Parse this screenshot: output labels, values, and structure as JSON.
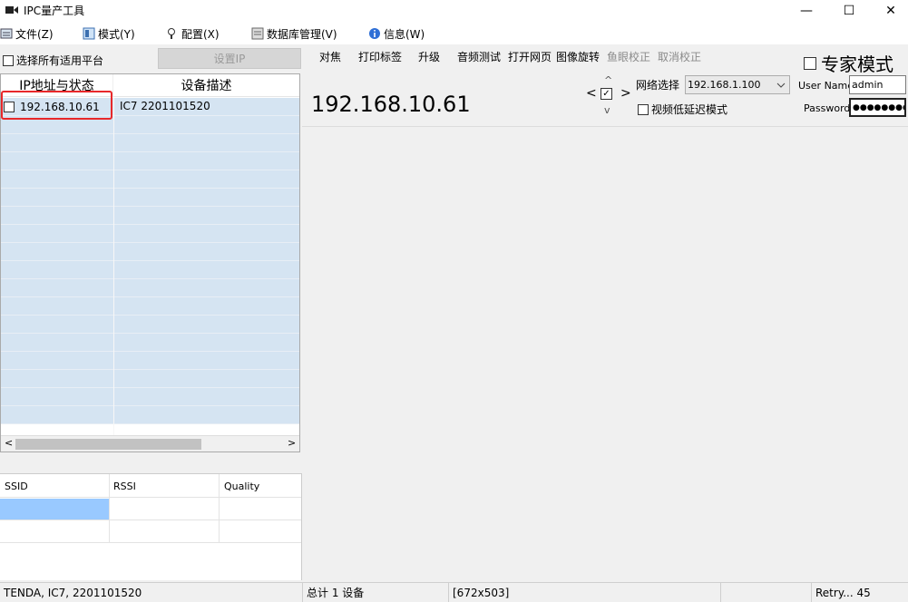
{
  "window": {
    "title": "IPC量产工具",
    "minimize": "—",
    "maximize": "☐",
    "close": "✕"
  },
  "menu": [
    {
      "label": "文件(Z)",
      "icon": "file-icon"
    },
    {
      "label": "模式(Y)",
      "icon": "mode-icon"
    },
    {
      "label": "配置(X)",
      "icon": "config-icon"
    },
    {
      "label": "数据库管理(V)",
      "icon": "database-icon"
    },
    {
      "label": "信息(W)",
      "icon": "info-icon"
    }
  ],
  "left": {
    "select_all_label": "选择所有适用平台",
    "set_ip_label": "设置IP",
    "columns": [
      "IP地址与状态",
      "设备描述"
    ],
    "devices": [
      {
        "ip": "192.168.10.61",
        "desc": "IC7 2201101520"
      }
    ]
  },
  "toolbar": [
    "对焦",
    "打印标签",
    "升级",
    "音频测试",
    "打开网页",
    "图像旋转",
    "鱼眼校正",
    "取消校正"
  ],
  "expert_mode_label": "专家模式",
  "current_ip": "192.168.10.61",
  "nav": {
    "up": "^",
    "down": "v",
    "left": "<",
    "right": ">"
  },
  "network": {
    "label": "网络选择",
    "selected": "192.168.1.100"
  },
  "low_latency_label": "视频低延迟模式",
  "auth": {
    "user_label": "User Name",
    "user_value": "admin",
    "pass_label": "Password",
    "pass_value": "●●●●●●●●●"
  },
  "wifi": {
    "columns": [
      "SSID",
      "RSSI",
      "Quality"
    ]
  },
  "status": {
    "device_info": "TENDA, IC7, 2201101520",
    "total": "总计 1 设备",
    "resolution": "[672x503]",
    "retry": "Retry... 45"
  },
  "colors": {
    "selection_box": "#e8282a",
    "row_fill": "#d5e4f2",
    "wifi_selected": "#99c9ff"
  }
}
